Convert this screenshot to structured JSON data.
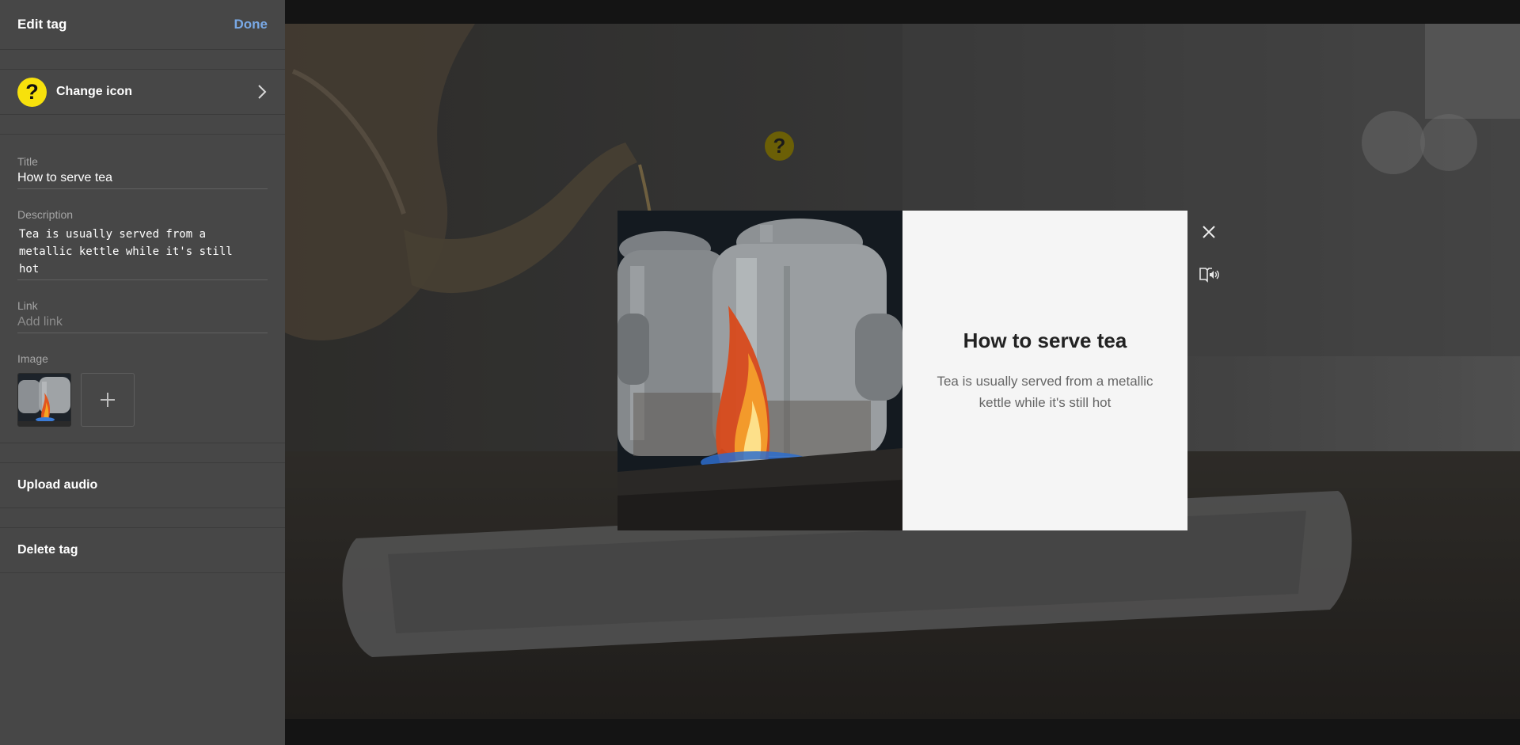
{
  "sidebar": {
    "header": {
      "title": "Edit tag",
      "done_label": "Done"
    },
    "change_icon": {
      "label": "Change icon",
      "icon": "question-mark-icon",
      "badge_color": "#f7e10c"
    },
    "fields": {
      "title_label": "Title",
      "title_value": "How to serve tea",
      "description_label": "Description",
      "description_value": "Tea is usually served from a\nmetallic kettle while it's still\nhot",
      "link_label": "Link",
      "link_placeholder": "Add link",
      "image_label": "Image"
    },
    "upload_audio_label": "Upload audio",
    "delete_tag_label": "Delete tag"
  },
  "stage": {
    "marker": {
      "glyph": "?",
      "icon": "question-mark-icon"
    }
  },
  "modal": {
    "title": "How to serve tea",
    "description": "Tea is usually served from a metallic kettle while it's still hot"
  },
  "marker_glyph": "?",
  "accent_color": "#79a9e6"
}
